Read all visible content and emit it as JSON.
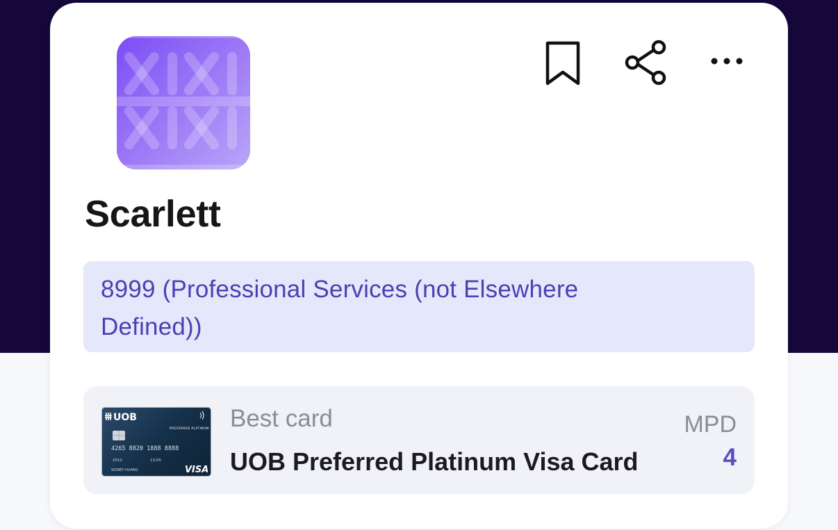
{
  "merchant": {
    "name": "Scarlett",
    "category": "8999 (Professional Services (not Elsewhere Defined))"
  },
  "actions": {
    "bookmark_icon": "bookmark-icon",
    "share_icon": "share-icon",
    "more_icon": "more-horizontal-icon"
  },
  "best_card": {
    "label": "Best card",
    "card_name": "UOB Preferred Platinum Visa Card",
    "metric_label": "MPD",
    "metric_value": "4",
    "card_image": {
      "brand": "UOB",
      "tier": "PREFERRED PLATINUM",
      "number": "4265 8820 1888 8888",
      "valid_from": "2012",
      "valid_thru": "11/20",
      "holder": "SIDNEY HUANG",
      "network": "VISA"
    }
  },
  "colors": {
    "header_bg": "#15073a",
    "accent": "#4a40b3",
    "category_bg": "#e4e8fa",
    "logo_purple": "#7b4df6"
  }
}
